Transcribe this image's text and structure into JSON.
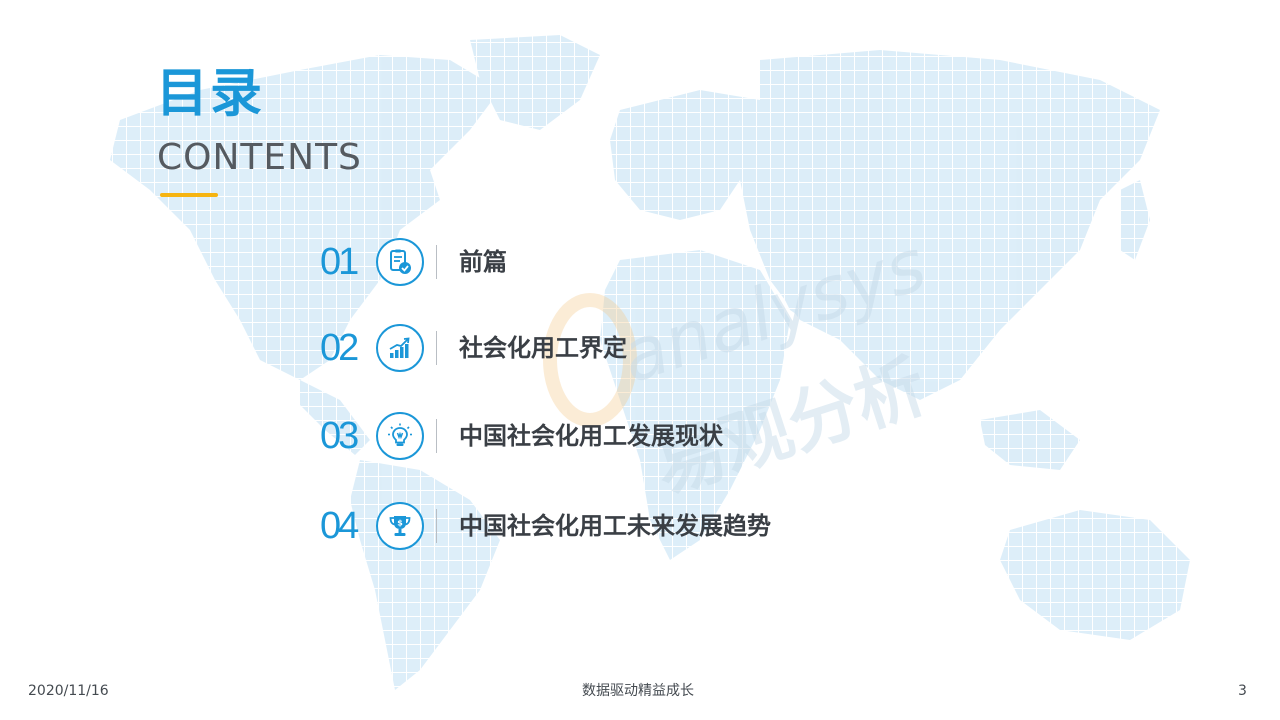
{
  "title": {
    "cn": "目录",
    "en": "CONTENTS"
  },
  "toc": [
    {
      "num": "01",
      "label": "前篇",
      "icon": "document-check-icon"
    },
    {
      "num": "02",
      "label": "社会化用工界定",
      "icon": "growth-chart-icon"
    },
    {
      "num": "03",
      "label": "中国社会化用工发展现状",
      "icon": "lightbulb-icon"
    },
    {
      "num": "04",
      "label": "中国社会化用工未来发展趋势",
      "icon": "trophy-dollar-icon"
    }
  ],
  "footer": {
    "date": "2020/11/16",
    "slogan": "数据驱动精益成长",
    "page": "3"
  },
  "watermark": {
    "brand_en": "analysys",
    "brand_cn": "易观分析"
  },
  "colors": {
    "accent": "#1b97d8",
    "underline": "#f6b411",
    "text": "#3a3f45",
    "map": "#d7ebf7"
  }
}
